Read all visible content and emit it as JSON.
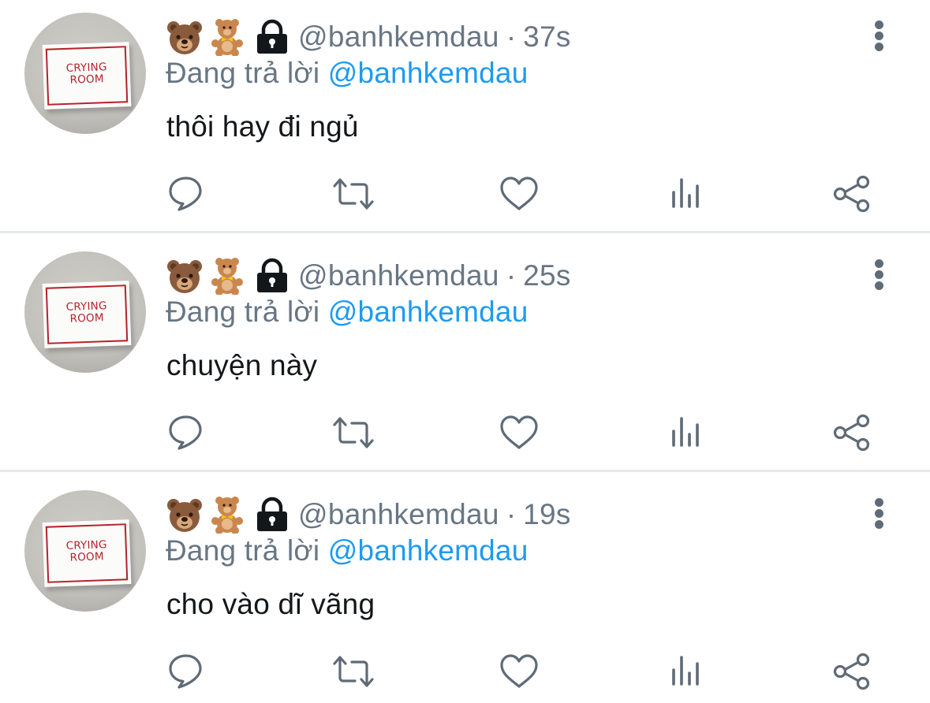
{
  "tweets": [
    {
      "avatar_text_line1": "CRYING",
      "avatar_text_line2": "ROOM",
      "handle": "@banhkemdau",
      "separator": "·",
      "time": "37s",
      "reply_label": "Đang trả lời",
      "reply_mention": "@banhkemdau",
      "text": "thôi hay đi ngủ"
    },
    {
      "avatar_text_line1": "CRYING",
      "avatar_text_line2": "ROOM",
      "handle": "@banhkemdau",
      "separator": "·",
      "time": "25s",
      "reply_label": "Đang trả lời",
      "reply_mention": "@banhkemdau",
      "text": "chuyện này"
    },
    {
      "avatar_text_line1": "CRYING",
      "avatar_text_line2": "ROOM",
      "handle": "@banhkemdau",
      "separator": "·",
      "time": "19s",
      "reply_label": "Đang trả lời",
      "reply_mention": "@banhkemdau",
      "text": "cho vào dĩ vãng"
    }
  ],
  "icons": {
    "name_emojis": [
      "bear-face-icon",
      "teddy-bear-icon",
      "lock-icon"
    ],
    "more": "more-vertical-icon",
    "actions": [
      "reply-icon",
      "retweet-icon",
      "like-icon",
      "analytics-icon",
      "share-icon"
    ]
  },
  "colors": {
    "secondary_text": "#687684",
    "mention": "#1d9bf0",
    "primary_text": "#14171a",
    "icon": "#5f6b77",
    "separator": "#e6e9ec"
  }
}
